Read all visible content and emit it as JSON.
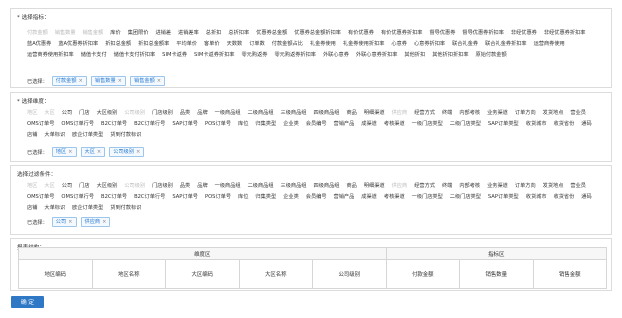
{
  "indicators": {
    "title": "* 选择指标：",
    "options": [
      {
        "label": "付款金额",
        "state": "sel"
      },
      {
        "label": "销售数量",
        "state": "sel"
      },
      {
        "label": "销售金额",
        "state": "sel"
      },
      {
        "label": "库价",
        "state": "normal"
      },
      {
        "label": "集团限价",
        "state": "normal"
      },
      {
        "label": "进销差",
        "state": "normal"
      },
      {
        "label": "进销差率",
        "state": "normal"
      },
      {
        "label": "总折扣",
        "state": "normal"
      },
      {
        "label": "总折扣率",
        "state": "normal"
      },
      {
        "label": "优惠券总金额",
        "state": "normal"
      },
      {
        "label": "优惠券总金额折扣率",
        "state": "normal"
      },
      {
        "label": "有价优惠券",
        "state": "normal"
      },
      {
        "label": "有价优惠券折扣率",
        "state": "normal"
      },
      {
        "label": "督导优惠券",
        "state": "normal"
      },
      {
        "label": "督导优惠券折扣率",
        "state": "normal"
      },
      {
        "label": "非经优惠券",
        "state": "normal"
      },
      {
        "label": "非经优惠券折扣率",
        "state": "normal"
      },
      {
        "label": "蓝A优惠券",
        "state": "normal"
      },
      {
        "label": "蓝A优惠券折扣率",
        "state": "normal"
      },
      {
        "label": "折扣总金额",
        "state": "normal"
      },
      {
        "label": "折扣总金额率",
        "state": "normal"
      },
      {
        "label": "平均单价",
        "state": "normal"
      },
      {
        "label": "客单价",
        "state": "normal"
      },
      {
        "label": "天数数",
        "state": "normal"
      },
      {
        "label": "订单数",
        "state": "normal"
      },
      {
        "label": "付款金额占比",
        "state": "normal"
      },
      {
        "label": "礼金券使用",
        "state": "normal"
      },
      {
        "label": "礼金券使用折扣率",
        "state": "normal"
      },
      {
        "label": "心意券",
        "state": "normal"
      },
      {
        "label": "心意券折扣率",
        "state": "normal"
      },
      {
        "label": "联合礼金券",
        "state": "normal"
      },
      {
        "label": "联合礼金券折扣率",
        "state": "normal"
      },
      {
        "label": "运营商券使用",
        "state": "normal"
      },
      {
        "label": "运营商券使用折扣率",
        "state": "normal"
      },
      {
        "label": "储值卡支付",
        "state": "normal"
      },
      {
        "label": "储值卡支付折扣率",
        "state": "normal"
      },
      {
        "label": "SIM卡返券",
        "state": "normal"
      },
      {
        "label": "SIM卡返券折扣率",
        "state": "normal"
      },
      {
        "label": "零元购返券",
        "state": "normal"
      },
      {
        "label": "零元购返券折扣率",
        "state": "normal"
      },
      {
        "label": "外联心意券",
        "state": "normal"
      },
      {
        "label": "外联心意券折扣率",
        "state": "normal"
      },
      {
        "label": "其他折扣",
        "state": "normal"
      },
      {
        "label": "其他折扣折扣率",
        "state": "normal"
      },
      {
        "label": "原始付款金额",
        "state": "normal"
      }
    ],
    "selected_label": "已选择：",
    "selected": [
      "付款金额",
      "销售数量",
      "销售金额"
    ]
  },
  "dimensions": {
    "title": "* 选择维度：",
    "options": [
      {
        "label": "地区",
        "state": "dim"
      },
      {
        "label": "大区",
        "state": "dim"
      },
      {
        "label": "公司",
        "state": "normal"
      },
      {
        "label": "门店",
        "state": "normal"
      },
      {
        "label": "大区级别",
        "state": "normal"
      },
      {
        "label": "公司级别",
        "state": "dim"
      },
      {
        "label": "门店级别",
        "state": "normal"
      },
      {
        "label": "品类",
        "state": "normal"
      },
      {
        "label": "品牌",
        "state": "normal"
      },
      {
        "label": "一级商品组",
        "state": "normal"
      },
      {
        "label": "二级商品组",
        "state": "normal"
      },
      {
        "label": "三级商品组",
        "state": "normal"
      },
      {
        "label": "四级商品组",
        "state": "normal"
      },
      {
        "label": "商品",
        "state": "normal"
      },
      {
        "label": "明细渠道",
        "state": "normal"
      },
      {
        "label": "供应商",
        "state": "dim"
      },
      {
        "label": "经营方式",
        "state": "normal"
      },
      {
        "label": "终端",
        "state": "normal"
      },
      {
        "label": "内部考核",
        "state": "normal"
      },
      {
        "label": "业务渠道",
        "state": "normal"
      },
      {
        "label": "订单方向",
        "state": "normal"
      },
      {
        "label": "发货地点",
        "state": "normal"
      },
      {
        "label": "营业员",
        "state": "normal"
      },
      {
        "label": "OMS订单号",
        "state": "normal"
      },
      {
        "label": "OMS订单行号",
        "state": "normal"
      },
      {
        "label": "B2C订单号",
        "state": "normal"
      },
      {
        "label": "B2C订单行号",
        "state": "normal"
      },
      {
        "label": "SAP订单号",
        "state": "normal"
      },
      {
        "label": "POS订单号",
        "state": "normal"
      },
      {
        "label": "库位",
        "state": "normal"
      },
      {
        "label": "归集类型",
        "state": "normal"
      },
      {
        "label": "企业类",
        "state": "normal"
      },
      {
        "label": "会员编号",
        "state": "normal"
      },
      {
        "label": "营销产品",
        "state": "normal"
      },
      {
        "label": "成渠道",
        "state": "normal"
      },
      {
        "label": "考核渠道",
        "state": "normal"
      },
      {
        "label": "一级门店类型",
        "state": "normal"
      },
      {
        "label": "二级门店类型",
        "state": "normal"
      },
      {
        "label": "SAP订单类型",
        "state": "normal"
      },
      {
        "label": "收货城市",
        "state": "normal"
      },
      {
        "label": "收货省份",
        "state": "normal"
      },
      {
        "label": "通码",
        "state": "normal"
      },
      {
        "label": "店铺",
        "state": "normal"
      },
      {
        "label": "大单标识",
        "state": "normal"
      },
      {
        "label": "欧企订单类型",
        "state": "normal"
      },
      {
        "label": "货到付款标识",
        "state": "normal"
      }
    ],
    "selected_label": "已选择：",
    "selected": [
      "地区",
      "大区",
      "公司级别"
    ]
  },
  "filters": {
    "title": "选择过滤条件：",
    "options": [
      {
        "label": "地区",
        "state": "dim"
      },
      {
        "label": "大区",
        "state": "dim"
      },
      {
        "label": "公司",
        "state": "normal"
      },
      {
        "label": "门店",
        "state": "normal"
      },
      {
        "label": "大区级别",
        "state": "normal"
      },
      {
        "label": "公司级别",
        "state": "dim"
      },
      {
        "label": "门店级别",
        "state": "normal"
      },
      {
        "label": "品类",
        "state": "normal"
      },
      {
        "label": "品牌",
        "state": "normal"
      },
      {
        "label": "一级商品组",
        "state": "normal"
      },
      {
        "label": "二级商品组",
        "state": "normal"
      },
      {
        "label": "三级商品组",
        "state": "normal"
      },
      {
        "label": "四级商品组",
        "state": "normal"
      },
      {
        "label": "商品",
        "state": "normal"
      },
      {
        "label": "明细渠道",
        "state": "normal"
      },
      {
        "label": "供应商",
        "state": "dim"
      },
      {
        "label": "经营方式",
        "state": "normal"
      },
      {
        "label": "终端",
        "state": "normal"
      },
      {
        "label": "内部考核",
        "state": "normal"
      },
      {
        "label": "业务渠道",
        "state": "normal"
      },
      {
        "label": "订单方向",
        "state": "normal"
      },
      {
        "label": "发货地点",
        "state": "normal"
      },
      {
        "label": "营业员",
        "state": "normal"
      },
      {
        "label": "OMS订单号",
        "state": "normal"
      },
      {
        "label": "OMS订单行号",
        "state": "normal"
      },
      {
        "label": "B2C订单号",
        "state": "normal"
      },
      {
        "label": "B2C订单行号",
        "state": "normal"
      },
      {
        "label": "SAP订单号",
        "state": "normal"
      },
      {
        "label": "POS订单号",
        "state": "normal"
      },
      {
        "label": "库位",
        "state": "normal"
      },
      {
        "label": "归集类型",
        "state": "normal"
      },
      {
        "label": "企业类",
        "state": "normal"
      },
      {
        "label": "会员编号",
        "state": "normal"
      },
      {
        "label": "营销产品",
        "state": "normal"
      },
      {
        "label": "成渠道",
        "state": "normal"
      },
      {
        "label": "考核渠道",
        "state": "normal"
      },
      {
        "label": "一级门店类型",
        "state": "normal"
      },
      {
        "label": "二级门店类型",
        "state": "normal"
      },
      {
        "label": "SAP订单类型",
        "state": "normal"
      },
      {
        "label": "收货城市",
        "state": "normal"
      },
      {
        "label": "收货省份",
        "state": "normal"
      },
      {
        "label": "通码",
        "state": "normal"
      },
      {
        "label": "店铺",
        "state": "normal"
      },
      {
        "label": "大单标识",
        "state": "normal"
      },
      {
        "label": "欧企订单类型",
        "state": "normal"
      },
      {
        "label": "货到付款标识",
        "state": "normal"
      }
    ],
    "selected_label": "已选择：",
    "selected": [
      "公司",
      "供应商"
    ]
  },
  "report": {
    "title": "报表结构：",
    "group_dimension": "维度区",
    "group_indicator": "指标区",
    "dimension_columns": [
      "地区编码",
      "地区名称",
      "大区编码",
      "大区名称",
      "公司级别"
    ],
    "indicator_columns": [
      "付款金额",
      "销售数量",
      "销售金额"
    ]
  },
  "confirm_label": "确 定",
  "colors": {
    "accent": "#2f78c5",
    "tag_border": "#9cc6ec",
    "tag_text": "#2b7bd0",
    "dim_text": "#bdbdbd"
  }
}
